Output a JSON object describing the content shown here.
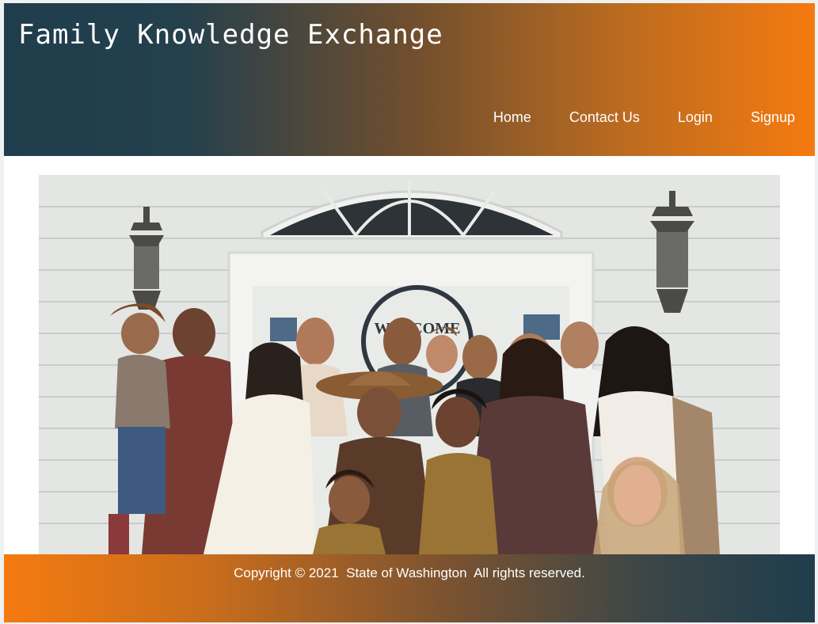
{
  "header": {
    "title": "Family Knowledge Exchange",
    "nav": [
      {
        "label": "Home"
      },
      {
        "label": "Contact Us"
      },
      {
        "label": "Login"
      },
      {
        "label": "Signup"
      }
    ]
  },
  "hero": {
    "sign_text": "WELCOME"
  },
  "footer": {
    "copyright": "Copyright © 2021  State of Washington  All rights reserved."
  },
  "colors": {
    "header_start": "#1f3d4c",
    "header_end": "#f57a10",
    "footer_start": "#f57a10",
    "footer_end": "#1f3d4c"
  }
}
